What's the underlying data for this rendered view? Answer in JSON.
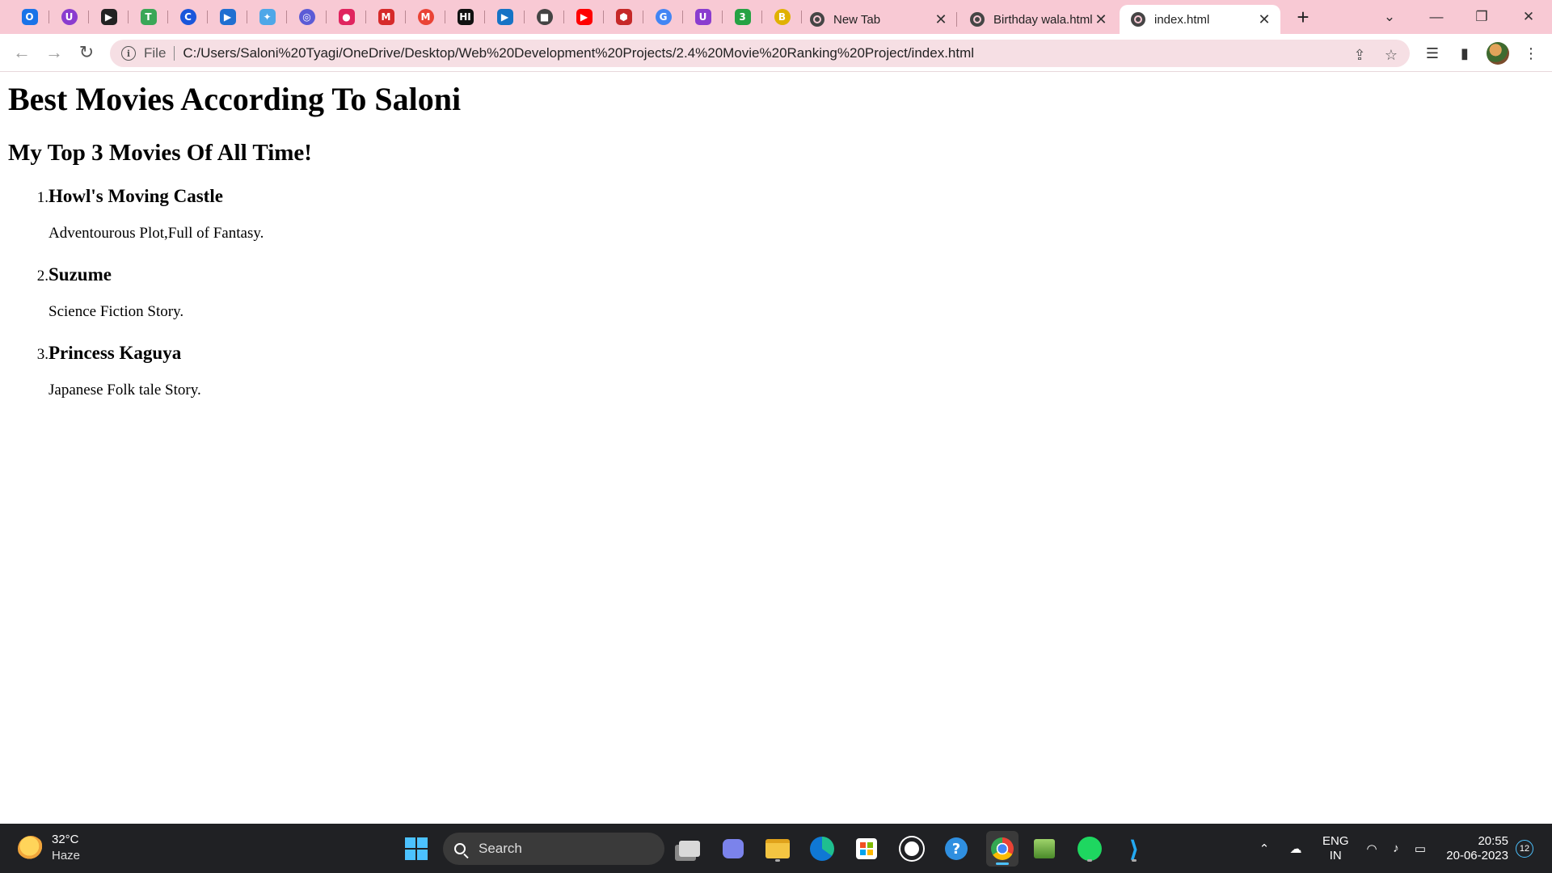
{
  "browser": {
    "pinned_tabs": [
      {
        "icon": "outlook-icon",
        "glyph": "O",
        "color": "#1a73e8"
      },
      {
        "icon": "u-extension-icon",
        "glyph": "U",
        "color": "#8a3ccf"
      },
      {
        "icon": "play-icon",
        "glyph": "▶",
        "color": "#222222"
      },
      {
        "icon": "tv-icon",
        "glyph": "T",
        "color": "#3aa757"
      },
      {
        "icon": "c-icon",
        "glyph": "C",
        "color": "#1a56db"
      },
      {
        "icon": "video-play-icon",
        "glyph": "▶",
        "color": "#1f6fd1"
      },
      {
        "icon": "arrow-icon",
        "glyph": "✦",
        "color": "#4ea7e8"
      },
      {
        "icon": "chat-icon",
        "glyph": "◎",
        "color": "#5b5bd6"
      },
      {
        "icon": "recorder-icon",
        "glyph": "●",
        "color": "#e0245e"
      },
      {
        "icon": "m-icon",
        "glyph": "M",
        "color": "#d62a2a"
      },
      {
        "icon": "gmail-icon",
        "glyph": "M",
        "color": "#ea4335"
      },
      {
        "icon": "hi-icon",
        "glyph": "HI",
        "color": "#111111"
      },
      {
        "icon": "media-icon",
        "glyph": "▶",
        "color": "#1673c5"
      },
      {
        "icon": "stop-icon",
        "glyph": "■",
        "color": "#444444"
      },
      {
        "icon": "youtube-icon",
        "glyph": "▶",
        "color": "#ff0000"
      },
      {
        "icon": "shield-icon",
        "glyph": "⬢",
        "color": "#c62828"
      },
      {
        "icon": "google-icon",
        "glyph": "G",
        "color": "#4285f4"
      },
      {
        "icon": "u-extension-icon",
        "glyph": "U",
        "color": "#8a3ccf"
      },
      {
        "icon": "whatsapp-icon",
        "glyph": "3",
        "color": "#25a244"
      },
      {
        "icon": "badge-icon",
        "glyph": "B",
        "color": "#e0b100"
      }
    ],
    "tabs": [
      {
        "title": "New Tab"
      },
      {
        "title": "Birthday wala.html"
      },
      {
        "title": "index.html"
      }
    ],
    "address": {
      "scheme_label": "File",
      "url": "C:/Users/Saloni%20Tyagi/OneDrive/Desktop/Web%20Development%20Projects/2.4%20Movie%20Ranking%20Project/index.html"
    }
  },
  "page": {
    "title": "Best Movies According To Saloni",
    "subtitle": "My Top 3 Movies Of All Time!",
    "movies": [
      {
        "number": "1.",
        "name": "Howl's Moving Castle",
        "description": "Adventourous Plot,Full of Fantasy."
      },
      {
        "number": "2.",
        "name": "Suzume",
        "description": "Science Fiction Story."
      },
      {
        "number": "3.",
        "name": "Princess Kaguya",
        "description": "Japanese Folk tale Story."
      }
    ]
  },
  "taskbar": {
    "weather": {
      "temp": "32°C",
      "condition": "Haze"
    },
    "search_label": "Search",
    "language": {
      "line1": "ENG",
      "line2": "IN"
    },
    "clock": {
      "time": "20:55",
      "date": "20-06-2023"
    },
    "notification_count": "12"
  }
}
